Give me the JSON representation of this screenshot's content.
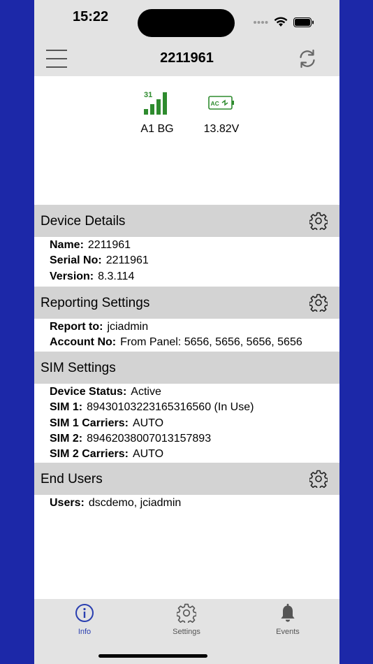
{
  "status_bar": {
    "time": "15:22"
  },
  "header": {
    "title": "2211961"
  },
  "status": {
    "signal_value": "31",
    "signal_label": "A1 BG",
    "power_badge": "AC",
    "power_label": "13.82V"
  },
  "sections": {
    "device_details": {
      "title": "Device Details",
      "rows": [
        {
          "key": "Name:",
          "value": "2211961"
        },
        {
          "key": "Serial No:",
          "value": "2211961"
        },
        {
          "key": "Version:",
          "value": "8.3.114"
        }
      ]
    },
    "reporting": {
      "title": "Reporting Settings",
      "rows": [
        {
          "key": "Report to:",
          "value": "jciadmin"
        },
        {
          "key": "Account No:",
          "value": "From Panel: 5656, 5656, 5656, 5656"
        }
      ]
    },
    "sim": {
      "title": "SIM Settings",
      "rows": [
        {
          "key": "Device Status:",
          "value": "Active"
        },
        {
          "key": "SIM 1:",
          "value": "89430103223165316560 (In Use)"
        },
        {
          "key": "SIM 1 Carriers:",
          "value": "AUTO"
        },
        {
          "key": "SIM 2:",
          "value": "89462038007013157893"
        },
        {
          "key": "SIM 2 Carriers:",
          "value": "AUTO"
        }
      ]
    },
    "end_users": {
      "title": "End Users",
      "rows": [
        {
          "key": "Users:",
          "value": "dscdemo, jciadmin"
        }
      ]
    }
  },
  "tabs": {
    "info": "Info",
    "settings": "Settings",
    "events": "Events"
  },
  "colors": {
    "background": "#1c28a8",
    "signal_green": "#2e8b2e",
    "tab_active": "#2a3fb0"
  },
  "icons": [
    "menu-icon",
    "refresh-icon",
    "signal-icon",
    "ac-power-icon",
    "gear-icon",
    "info-icon",
    "bell-icon"
  ]
}
